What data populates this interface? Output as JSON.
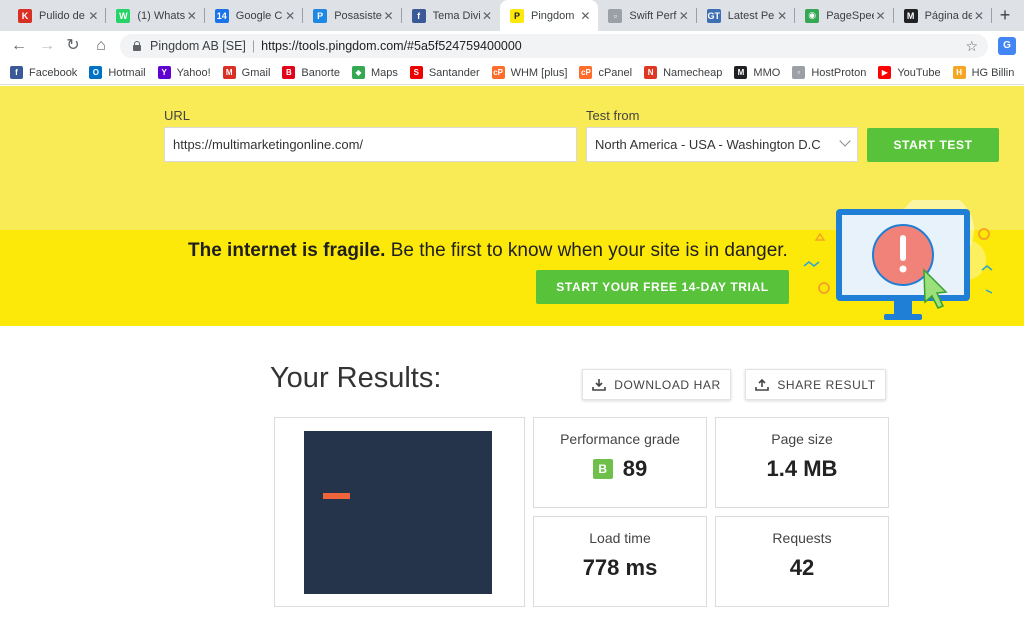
{
  "tabs": [
    {
      "title": "Pulido de",
      "fav": "K",
      "color": "#d93025"
    },
    {
      "title": "(1) Whats",
      "fav": "W",
      "color": "#25d366"
    },
    {
      "title": "Google C",
      "fav": "14",
      "color": "#1a73e8"
    },
    {
      "title": "Posasiste",
      "fav": "P",
      "color": "#1e88e5"
    },
    {
      "title": "Tema Divi",
      "fav": "f",
      "color": "#3b5998"
    },
    {
      "title": "Pingdom",
      "fav": "P",
      "color": "#fce90a",
      "active": true
    },
    {
      "title": "Swift Perf",
      "fav": "▫",
      "color": "#9aa0a6"
    },
    {
      "title": "Latest Pe",
      "fav": "GT",
      "color": "#3e6fb4"
    },
    {
      "title": "PageSpee",
      "fav": "◉",
      "color": "#34a853"
    },
    {
      "title": "Página de",
      "fav": "M",
      "color": "#202124"
    }
  ],
  "address": {
    "site": "Pingdom AB [SE]",
    "url": "https://tools.pingdom.com/#5a5f524759400000"
  },
  "bookmarks": [
    {
      "label": "Facebook",
      "fav": "f",
      "color": "#3b5998"
    },
    {
      "label": "Hotmail",
      "fav": "O",
      "color": "#0072c6"
    },
    {
      "label": "Yahoo!",
      "fav": "Y",
      "color": "#5f01d1"
    },
    {
      "label": "Gmail",
      "fav": "M",
      "color": "#d93025"
    },
    {
      "label": "Banorte",
      "fav": "B",
      "color": "#e2001a"
    },
    {
      "label": "Maps",
      "fav": "◆",
      "color": "#34a853"
    },
    {
      "label": "Santander",
      "fav": "S",
      "color": "#ec0000"
    },
    {
      "label": "WHM [plus]",
      "fav": "cP",
      "color": "#ff6c2c"
    },
    {
      "label": "cPanel",
      "fav": "cP",
      "color": "#ff6c2c"
    },
    {
      "label": "Namecheap",
      "fav": "N",
      "color": "#de3723"
    },
    {
      "label": "MMO",
      "fav": "M",
      "color": "#202124"
    },
    {
      "label": "HostProton",
      "fav": "▫",
      "color": "#9aa0a6"
    },
    {
      "label": "YouTube",
      "fav": "▶",
      "color": "#ff0000"
    },
    {
      "label": "HG Billin",
      "fav": "H",
      "color": "#f5a623"
    }
  ],
  "form": {
    "url_label": "URL",
    "url_value": "https://multimarketingonline.com/",
    "test_from_label": "Test from",
    "test_from_value": "North America - USA - Washington D.C",
    "start_test": "START TEST"
  },
  "promo": {
    "headline_bold": "The internet is fragile.",
    "headline_rest": " Be the first to know when your site is in danger.",
    "trial_button": "START YOUR FREE 14-DAY TRIAL"
  },
  "results": {
    "title": "Your Results:",
    "download_har": "DOWNLOAD HAR",
    "share_result": "SHARE RESULT",
    "performance_label": "Performance grade",
    "performance_letter": "B",
    "performance_value": "89",
    "page_size_label": "Page size",
    "page_size_value": "1.4 MB",
    "load_time_label": "Load time",
    "load_time_value": "778 ms",
    "requests_label": "Requests",
    "requests_value": "42"
  },
  "colors": {
    "brand_yellow": "#fce90a",
    "accent_green": "#58c23b",
    "grade_green": "#6fc04b"
  }
}
